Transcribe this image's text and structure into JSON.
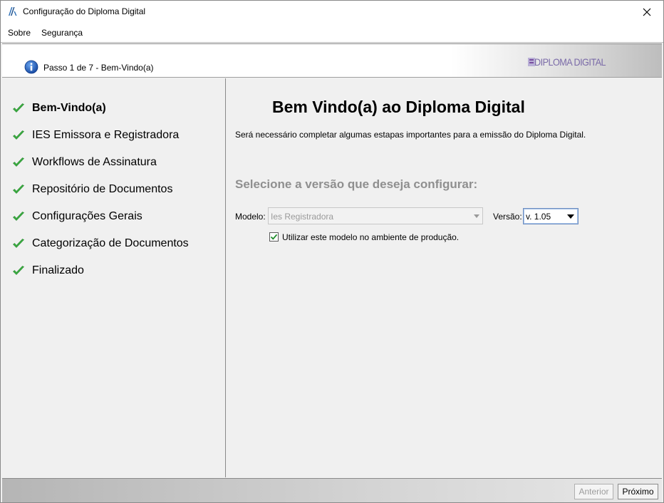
{
  "window": {
    "title": "Configuração do Diploma Digital",
    "icon": "app-logo-icon",
    "close_icon": "close-icon"
  },
  "menu": {
    "items": [
      {
        "label": "Sobre"
      },
      {
        "label": "Segurança"
      }
    ]
  },
  "stepbar": {
    "text": "Passo 1 de 7 - Bem-Vindo(a)",
    "icon": "info-icon",
    "logo_text": "DIPLOMA DIGITAL"
  },
  "sidebar": {
    "items": [
      {
        "label": "Bem-Vindo(a)",
        "active": true,
        "status": "done"
      },
      {
        "label": "IES Emissora e Registradora",
        "status": "done"
      },
      {
        "label": "Workflows de Assinatura",
        "status": "done"
      },
      {
        "label": "Repositório de Documentos",
        "status": "done"
      },
      {
        "label": "Configurações Gerais",
        "status": "done"
      },
      {
        "label": "Categorização de Documentos",
        "status": "done"
      },
      {
        "label": "Finalizado",
        "status": "done"
      }
    ]
  },
  "content": {
    "heading": "Bem Vindo(a) ao Diploma Digital",
    "description": "Será necessário completar algumas estapas importantes para a emissão do Diploma Digital.",
    "subheading": "Selecione a versão que deseja configurar:",
    "model_label": "Modelo:",
    "model_value": "Ies Registradora",
    "version_label": "Versão:",
    "version_value": "v. 1.05",
    "production_checkbox_label": "Utilizar este modelo no ambiente de produção.",
    "production_checked": true
  },
  "footer": {
    "back_label": "Anterior",
    "next_label": "Próximo"
  },
  "colors": {
    "check_green": "#3cb043",
    "info_blue": "#1f5fbf",
    "logo_purple": "#7a4fa0"
  }
}
